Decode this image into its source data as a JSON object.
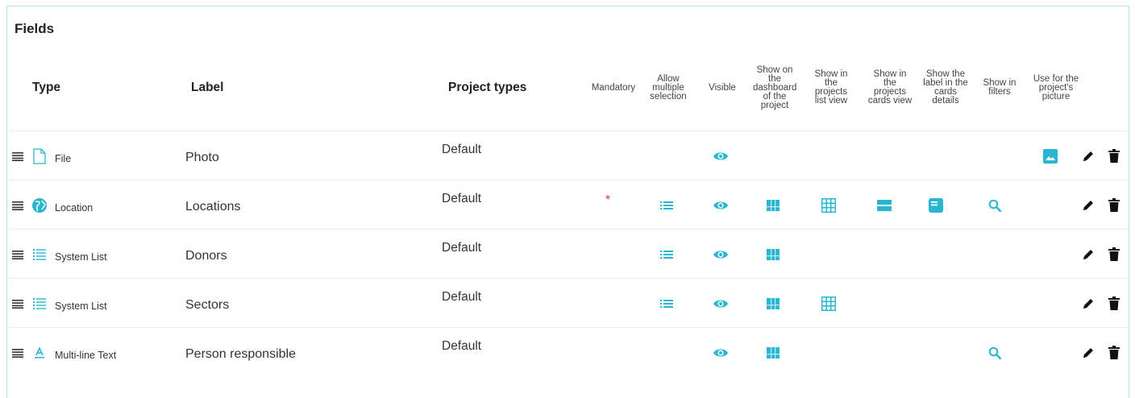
{
  "panel": {
    "title": "Fields"
  },
  "columns": {
    "type": "Type",
    "label": "Label",
    "project_types": "Project types",
    "mandatory": "Mandatory",
    "multiple": [
      "Allow",
      "multiple",
      "selection"
    ],
    "visible": "Visible",
    "dashboard": [
      "Show on",
      "the",
      "dashboard",
      "of the",
      "project"
    ],
    "list_view": [
      "Show in",
      "the",
      "projects",
      "list view"
    ],
    "cards_view": [
      "Show in",
      "the",
      "projects",
      "cards view"
    ],
    "label_cards": [
      "Show the",
      "label in the",
      "cards",
      "details"
    ],
    "filters": [
      "Show in",
      "filters"
    ],
    "picture": [
      "Use for the",
      "project's",
      "picture"
    ]
  },
  "rows": [
    {
      "type_icon": "file-icon",
      "type": "File",
      "label": "Photo",
      "project_type": "Default",
      "mandatory": false,
      "multiple": false,
      "visible": true,
      "dashboard": false,
      "list_view": false,
      "cards_view": false,
      "label_cards": false,
      "filters": false,
      "picture": true
    },
    {
      "type_icon": "globe-icon",
      "type": "Location",
      "label": "Locations",
      "project_type": "Default",
      "mandatory": true,
      "multiple": true,
      "visible": true,
      "dashboard": true,
      "list_view": true,
      "cards_view": true,
      "label_cards": true,
      "filters": true,
      "picture": false
    },
    {
      "type_icon": "list-icon",
      "type": "System List",
      "label": "Donors",
      "project_type": "Default",
      "mandatory": false,
      "multiple": true,
      "visible": true,
      "dashboard": true,
      "list_view": false,
      "cards_view": false,
      "label_cards": false,
      "filters": false,
      "picture": false
    },
    {
      "type_icon": "list-icon",
      "type": "System List",
      "label": "Sectors",
      "project_type": "Default",
      "mandatory": false,
      "multiple": true,
      "visible": true,
      "dashboard": true,
      "list_view": true,
      "cards_view": false,
      "label_cards": false,
      "filters": false,
      "picture": false
    },
    {
      "type_icon": "text-icon",
      "type": "Multi-line Text",
      "label": "Person responsible",
      "project_type": "Default",
      "mandatory": false,
      "multiple": false,
      "visible": true,
      "dashboard": true,
      "list_view": false,
      "cards_view": false,
      "label_cards": false,
      "filters": true,
      "picture": false
    }
  ],
  "mandatory_marker": "*",
  "colors": {
    "accent": "#29b6d1",
    "border": "#b9e3ec",
    "mandatory": "#e53935"
  }
}
